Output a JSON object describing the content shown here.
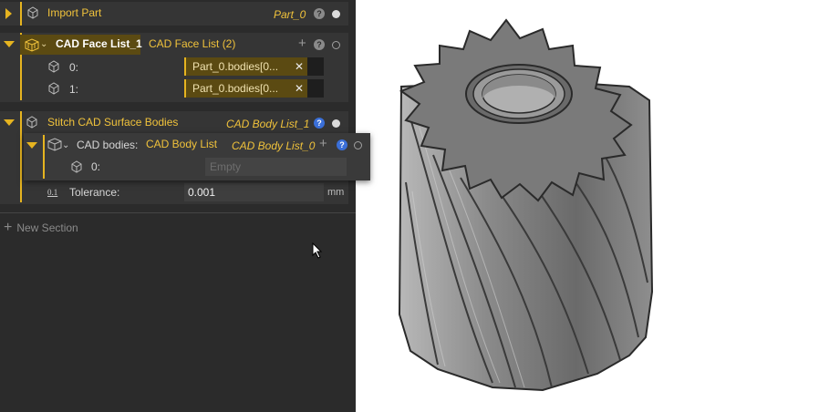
{
  "import_part": {
    "title": "Import Part",
    "value": "Part_0"
  },
  "face_list": {
    "title": "CAD Face List_1",
    "type_label": "CAD Face List (2)",
    "items": [
      {
        "index": "0:",
        "value": "Part_0.bodies[0..."
      },
      {
        "index": "1:",
        "value": "Part_0.bodies[0..."
      }
    ]
  },
  "stitch": {
    "title": "Stitch CAD Surface Bodies",
    "value": "CAD Body List_1",
    "bodies_label": "CAD bodies:",
    "bodies_type": "CAD Body List",
    "bodies_value": "CAD Body List_0",
    "body_item": {
      "index": "0:",
      "placeholder": "Empty"
    },
    "tolerance": {
      "label": "Tolerance:",
      "value": "0.001",
      "unit": "mm",
      "icon_text": "0.1"
    }
  },
  "new_section": "New Section",
  "icons": {
    "help": "?",
    "plus": "+",
    "remove": "✕"
  },
  "colors": {
    "accent": "#e6b420",
    "panel_bg": "#2b2b2b",
    "section_bg": "#353535",
    "help_blue": "#3a6fd8",
    "gear_gray": "#777777"
  }
}
